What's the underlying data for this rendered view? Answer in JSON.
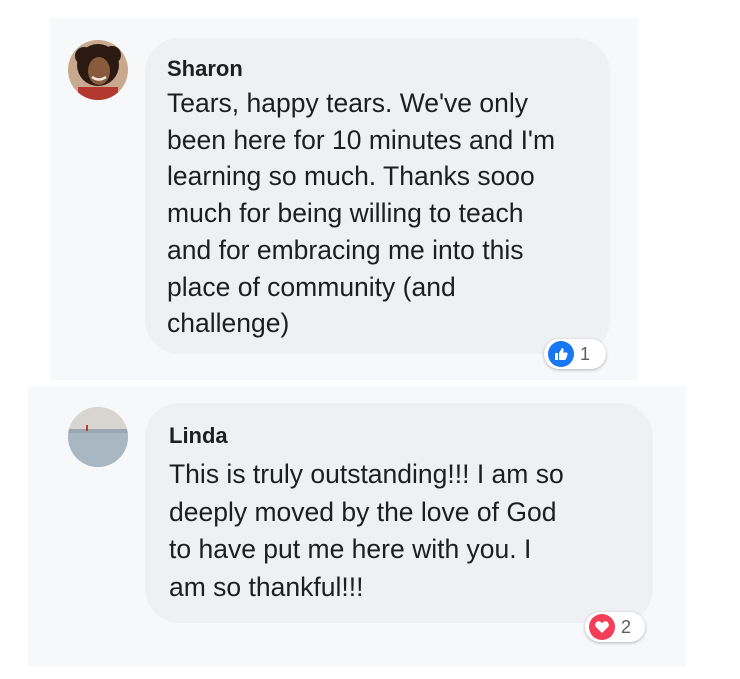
{
  "comments": [
    {
      "author": "Sharon",
      "text": "Tears, happy tears. We've only\nbeen here for 10 minutes and I'm\nlearning so much. Thanks sooo\nmuch for being willing to teach\nand for embracing me into this\nplace of community (and\nchallenge)",
      "reaction": {
        "icon": "like-icon",
        "color": "#1877f2",
        "count": "1"
      }
    },
    {
      "author": "Linda",
      "text": "This is truly outstanding!!! I am so\ndeeply moved by the love of God\nto have put me here with you. I\nam so thankful!!!",
      "reaction": {
        "icon": "love-icon",
        "color": "#f33e58",
        "count": "2"
      }
    }
  ]
}
